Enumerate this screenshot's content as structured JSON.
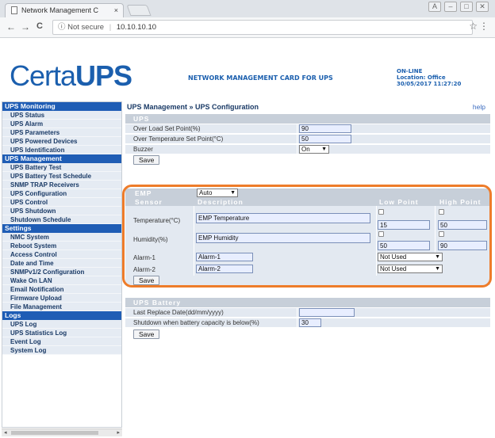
{
  "browser": {
    "tab_title": "Network Management C",
    "tab_close": "×",
    "security_label": "ⓘ Not secure",
    "separator": "|",
    "url": "10.10.10.10",
    "back": "←",
    "forward": "→",
    "reload": "C",
    "star": "☆",
    "menu": "⋮",
    "win_user": "A",
    "win_min": "–",
    "win_max": "□",
    "win_close": "✕"
  },
  "header": {
    "logo_thin": "Certa",
    "logo_bold": "UPS",
    "nmc_title": "NETWORK MANAGEMENT CARD FOR UPS",
    "status": "ON-LINE",
    "location": "Location: Office",
    "datetime": "30/05/2017 11:27:20"
  },
  "sidebar": {
    "groups": [
      {
        "title": "UPS Monitoring",
        "items": [
          "UPS Status",
          "UPS Alarm",
          "UPS Parameters",
          "UPS Powered Devices",
          "UPS Identification"
        ]
      },
      {
        "title": "UPS Management",
        "items": [
          "UPS Battery Test",
          "UPS Battery Test Schedule",
          "SNMP TRAP Receivers",
          "UPS Configuration",
          "UPS Control",
          "UPS Shutdown",
          "Shutdown Schedule"
        ]
      },
      {
        "title": "Settings",
        "items": [
          "NMC System",
          "Reboot System",
          "Access Control",
          "Date and Time",
          "SNMPv1/2 Configuration",
          "Wake On LAN",
          "Email Notification",
          "Firmware Upload",
          "File Management"
        ]
      },
      {
        "title": "Logs",
        "items": [
          "UPS Log",
          "UPS Statistics Log",
          "Event Log",
          "System Log"
        ]
      }
    ],
    "scroll_left": "◂",
    "scroll_right": "▸"
  },
  "main": {
    "breadcrumb": "UPS Management » UPS Configuration",
    "help": "help",
    "ups": {
      "title": "UPS",
      "over_load_label": "Over Load Set Point(%)",
      "over_load_value": "90",
      "over_temp_label": "Over Temperature Set Point(°C)",
      "over_temp_value": "50",
      "buzzer_label": "Buzzer",
      "buzzer_value": "On",
      "save": "Save"
    },
    "emp": {
      "title": "EMP",
      "mode": "Auto",
      "col_sensor": "Sensor",
      "col_description": "Description",
      "col_low": "Low Point",
      "col_high": "High Point",
      "temp_label": "Temperature(°C)",
      "temp_desc": "EMP Temperature",
      "temp_low": "15",
      "temp_high": "50",
      "hum_label": "Humidity(%)",
      "hum_desc": "EMP Humidity",
      "hum_low": "50",
      "hum_high": "90",
      "alarm1_label": "Alarm-1",
      "alarm1_name": "Alarm-1",
      "alarm1_mode": "Not Used",
      "alarm2_label": "Alarm-2",
      "alarm2_name": "Alarm-2",
      "alarm2_mode": "Not Used",
      "save": "Save"
    },
    "battery": {
      "title": "UPS Battery",
      "replace_label": "Last Replace Date(dd/mm/yyyy)",
      "replace_value": "",
      "shutdown_label": "Shutdown when battery capacity is below(%)",
      "shutdown_value": "30",
      "save": "Save"
    }
  },
  "colors": {
    "brand_blue": "#1b5fae",
    "sidebar_group": "#1f5db5",
    "highlight_ring": "#ee7c2a"
  }
}
